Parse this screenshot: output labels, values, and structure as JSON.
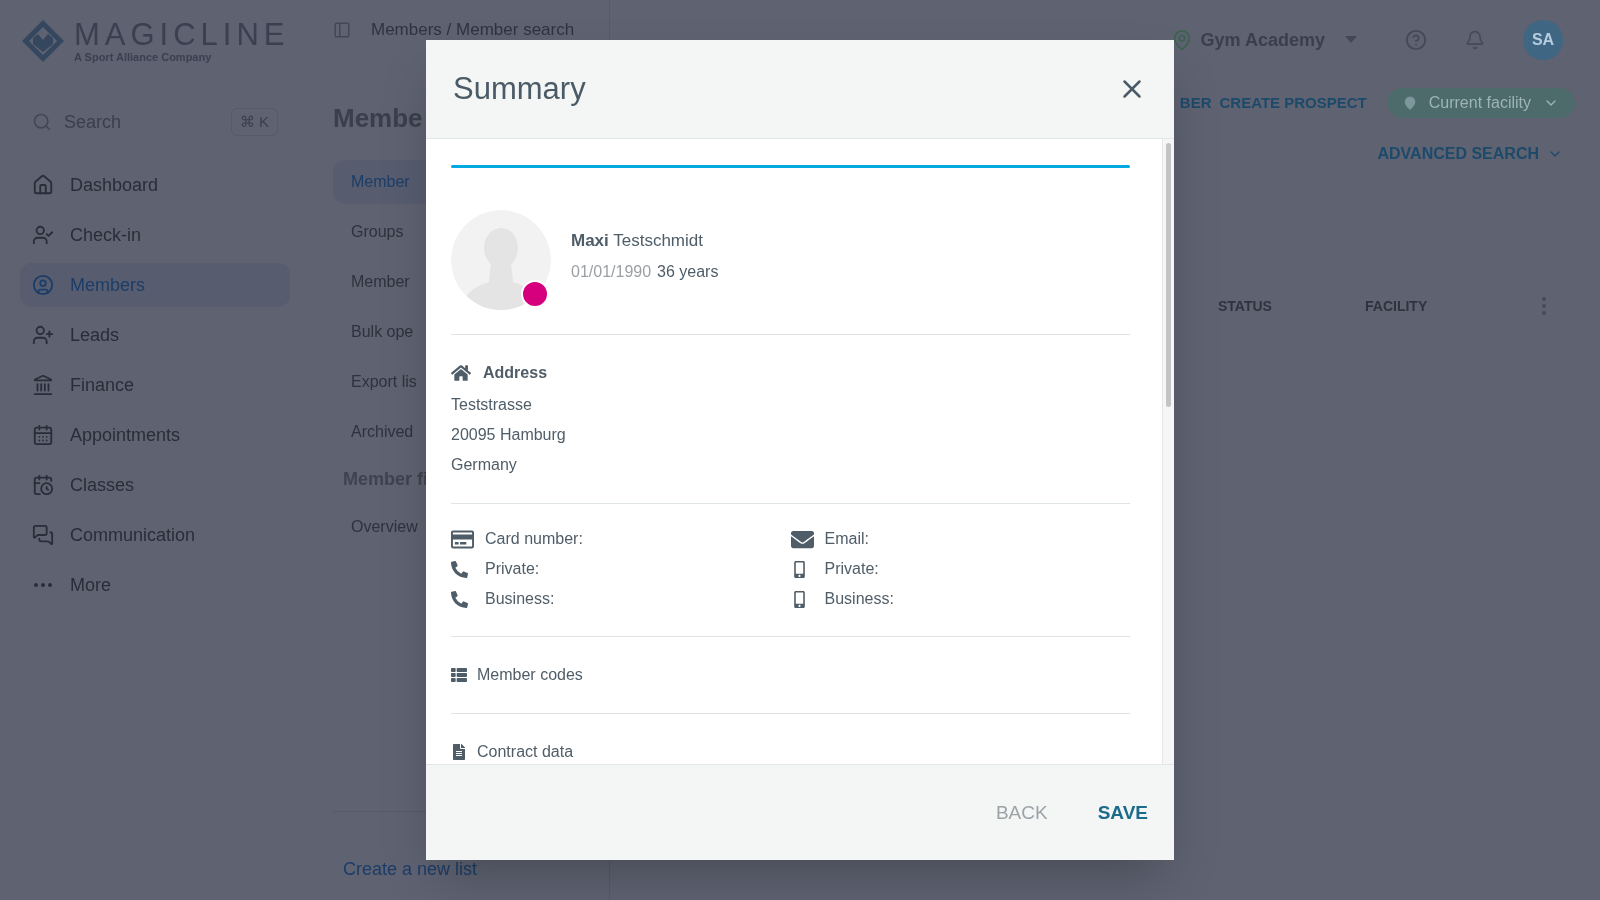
{
  "header": {
    "logo": {
      "name": "MAGICLINE",
      "tagline": "A Sport Alliance Company"
    },
    "breadcrumb": {
      "items": [
        "Members",
        "Member search"
      ],
      "separator": "/"
    },
    "facility": "Gym Academy",
    "avatar": "SA"
  },
  "sidebar": {
    "search": {
      "placeholder": "Search",
      "shortcut": "⌘ K"
    },
    "items": [
      {
        "label": "Dashboard",
        "selected": false
      },
      {
        "label": "Check-in",
        "selected": false
      },
      {
        "label": "Members",
        "selected": true
      },
      {
        "label": "Leads",
        "selected": false
      },
      {
        "label": "Finance",
        "selected": false
      },
      {
        "label": "Appointments",
        "selected": false
      },
      {
        "label": "Classes",
        "selected": false
      },
      {
        "label": "Communication",
        "selected": false
      },
      {
        "label": "More",
        "selected": false
      }
    ]
  },
  "subnav": {
    "title": "Membe",
    "items": [
      {
        "label": "Member",
        "selected": true
      },
      {
        "label": "Groups",
        "selected": false
      },
      {
        "label": "Member",
        "selected": false
      },
      {
        "label": "Bulk ope",
        "selected": false
      },
      {
        "label": "Export lis",
        "selected": false
      },
      {
        "label": "Archived",
        "selected": false
      }
    ],
    "section": "Member fi",
    "section_items": [
      "Overview"
    ],
    "footer_link": "Create a new list"
  },
  "content": {
    "actions": [
      "BER",
      "CREATE PROSPECT"
    ],
    "facility_filter": "Current facility",
    "advanced_search": "ADVANCED SEARCH",
    "columns": [
      "STATUS",
      "FACILITY"
    ]
  },
  "modal": {
    "title": "Summary",
    "progress": {
      "level": 1
    },
    "member": {
      "first_name": "Maxi",
      "last_name": "Testschmidt",
      "birth_date": "01/01/1990",
      "age": "36 years"
    },
    "address": {
      "heading": "Address",
      "lines": [
        "Teststrasse",
        "20095 Hamburg",
        "Germany"
      ]
    },
    "contacts": [
      [
        {
          "kind": "card",
          "label": "Card number:"
        },
        {
          "kind": "phone",
          "label": "Private:"
        },
        {
          "kind": "phone",
          "label": "Business:"
        }
      ],
      [
        {
          "kind": "email",
          "label": "Email:"
        },
        {
          "kind": "mobile",
          "label": "Private:"
        },
        {
          "kind": "mobile",
          "label": "Business:"
        }
      ]
    ],
    "sections": [
      {
        "kind": "codes",
        "label": "Member codes"
      },
      {
        "kind": "contract",
        "label": "Contract data"
      }
    ],
    "buttons": {
      "back": "BACK",
      "save": "SAVE"
    }
  }
}
